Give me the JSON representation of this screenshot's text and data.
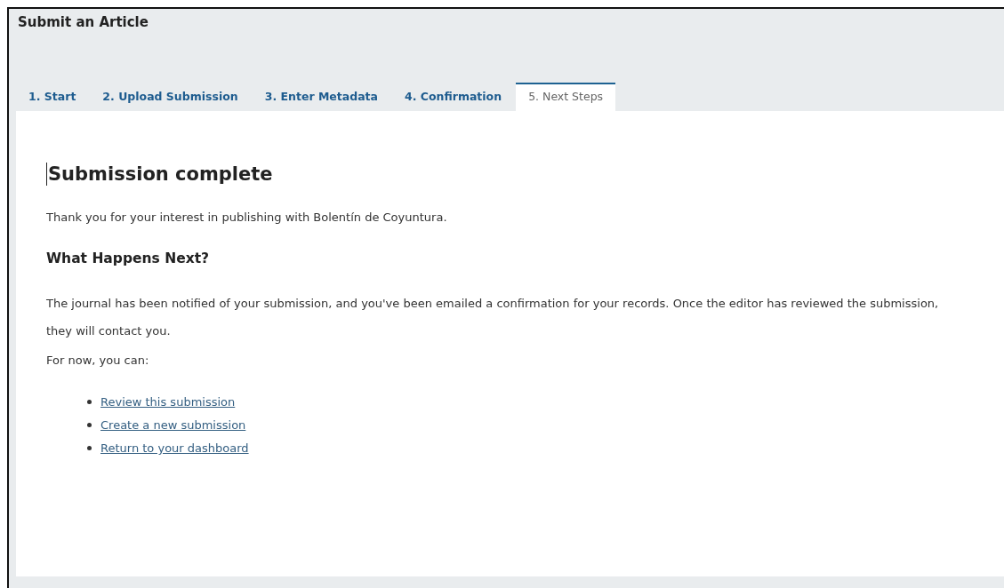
{
  "page_title": "Submit an Article",
  "tabs": [
    {
      "label": "1. Start",
      "selected": false
    },
    {
      "label": "2. Upload Submission",
      "selected": false
    },
    {
      "label": "3. Enter Metadata",
      "selected": false
    },
    {
      "label": "4. Confirmation",
      "selected": false
    },
    {
      "label": "5. Next Steps",
      "selected": true
    }
  ],
  "content": {
    "heading": "Submission complete",
    "thanks": "Thank you for your interest in publishing with Bolentín de Coyuntura.",
    "subheading": "What Happens Next?",
    "paragraph": "The journal has been notified of your submission, and you've been emailed a confirmation for your records. Once the editor has reviewed the submission, they will contact you.",
    "intro": "For now, you can:",
    "links": [
      {
        "label": "Review this submission"
      },
      {
        "label": "Create a new submission"
      },
      {
        "label": "Return to your dashboard"
      }
    ]
  }
}
